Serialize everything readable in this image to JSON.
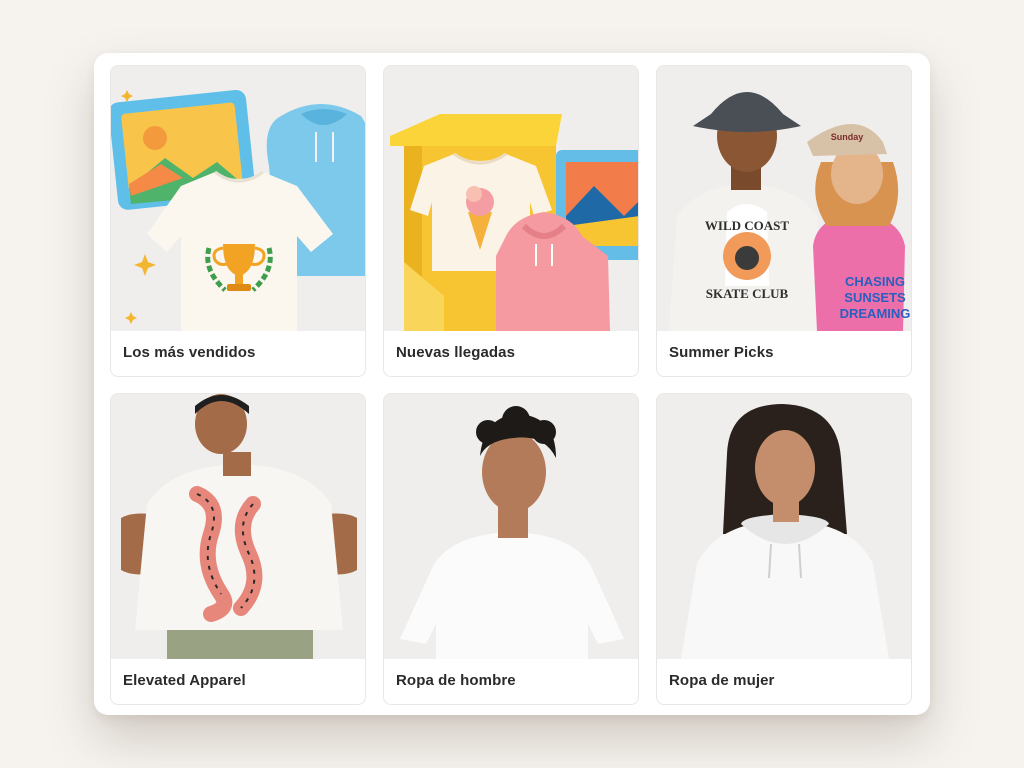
{
  "categories": [
    {
      "label": "Los más vendidos",
      "illustration": "trophy-tshirt-icon"
    },
    {
      "label": "Nuevas llegadas",
      "illustration": "new-arrivals-box-icon"
    },
    {
      "label": "Summer Picks",
      "illustration": "summer-models-photo"
    },
    {
      "label": "Elevated Apparel",
      "illustration": "tiger-tee-model-photo"
    },
    {
      "label": "Ropa de hombre",
      "illustration": "mens-white-tee-photo"
    },
    {
      "label": "Ropa de mujer",
      "illustration": "womens-hoodie-photo"
    }
  ],
  "graphics": {
    "tee_texts": [
      "WILD COAST",
      "SKATE CLUB",
      "CHASING",
      "SUNSETS",
      "DREAMING"
    ],
    "cap_text": "Sunday"
  },
  "colors": {
    "page_bg": "#f6f3ef",
    "panel_bg": "#ffffff",
    "label_text": "#2b2b2b",
    "sky_blue": "#7cc9ec",
    "sunny_yellow": "#f7c531",
    "pink": "#f49da3"
  }
}
